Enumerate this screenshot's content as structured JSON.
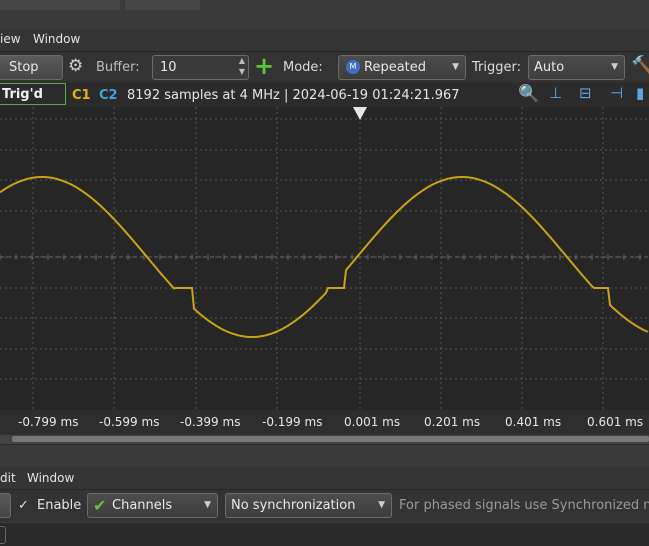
{
  "top_menu": {
    "view_fragment": "iew",
    "window": "Window"
  },
  "toolbar": {
    "stop_label": "Stop",
    "buffer_label": "Buffer:",
    "buffer_value": "10",
    "mode_label": "Mode:",
    "mode_value": "Repeated",
    "trigger_label": "Trigger:",
    "trigger_value": "Auto"
  },
  "status_bar": {
    "trig_state": "Trig'd",
    "ch1": "C1",
    "ch2": "C2",
    "info": "8192 samples at 4 MHz",
    "timestamp": "| 2024-06-19 01:24:21.967"
  },
  "x_axis": {
    "ticks": [
      "-0.799 ms",
      "-0.599 ms",
      "-0.399 ms",
      "-0.199 ms",
      "0.001 ms",
      "0.201 ms",
      "0.401 ms",
      "0.601 ms"
    ]
  },
  "bottom_menu": {
    "edit_fragment": "dit",
    "window": "Window"
  },
  "bottom_toolbar": {
    "enable_label": "Enable",
    "channels_value": "Channels",
    "sync_value": "No synchronization",
    "hint": "For phased signals use Synchronized mo"
  },
  "colors": {
    "trace": "#c8a50f",
    "c1": "#e0b40e",
    "c2": "#3aa7d9",
    "grid_bg": "#262626"
  },
  "chart_data": {
    "type": "line",
    "series": [
      {
        "name": "C1",
        "color": "#c8a50f"
      }
    ],
    "x_unit": "ms",
    "x_ticks": [
      -0.799,
      -0.599,
      -0.399,
      -0.199,
      0.001,
      0.201,
      0.401,
      0.601
    ],
    "grid": true
  }
}
